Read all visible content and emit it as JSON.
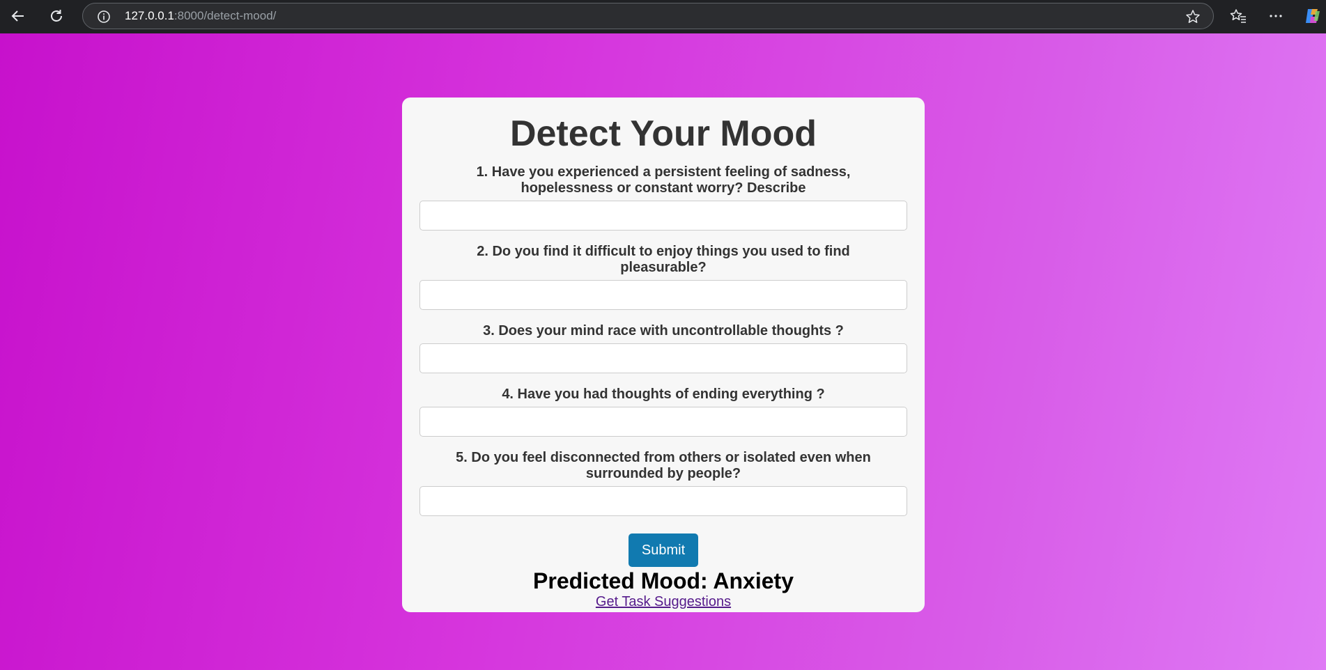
{
  "browser": {
    "url_host": "127.0.0.1",
    "url_rest": ":8000/detect-mood/"
  },
  "page": {
    "title": "Detect Your Mood",
    "questions": [
      {
        "label": "1. Have you experienced a persistent feeling of sadness, hopelessness or constant worry? Describe",
        "value": ""
      },
      {
        "label": "2. Do you find it difficult to enjoy things you used to find pleasurable?",
        "value": ""
      },
      {
        "label": "3. Does your mind race with uncontrollable thoughts ?",
        "value": ""
      },
      {
        "label": "4. Have you had thoughts of ending everything ?",
        "value": ""
      },
      {
        "label": "5. Do you feel disconnected from others or isolated even when surrounded by people?",
        "value": ""
      }
    ],
    "submit_label": "Submit",
    "result_text": "Predicted Mood: Anxiety",
    "link_text": "Get Task Suggestions"
  },
  "colors": {
    "submit_bg": "#117ab0",
    "card_bg": "#f7f7f7",
    "gradient_start": "#c711cc",
    "gradient_end": "#df7af5"
  }
}
